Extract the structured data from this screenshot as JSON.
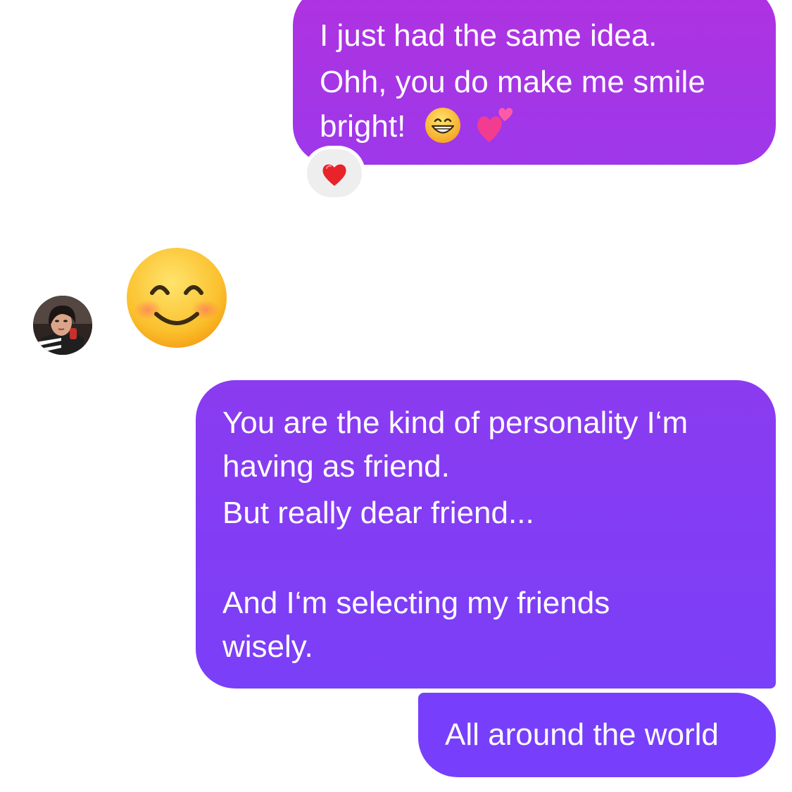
{
  "messages": {
    "first": {
      "line1": "I just had the same idea.",
      "line2": "Ohh, you do make me smile",
      "line3": "bright!",
      "emojis": [
        "grinning-face-icon",
        "two-hearts-icon"
      ],
      "reaction": "red-heart-icon"
    },
    "incoming": {
      "sender": "contact",
      "emoji": "smiling-face-with-smiling-eyes-icon"
    },
    "second": {
      "line1": "You are the kind of personality I‘m",
      "line2": "having as friend.",
      "line3": "But really dear friend...",
      "line4": "And I‘m selecting my friends",
      "line5": "wisely."
    },
    "third": {
      "text": "All around the world"
    }
  },
  "colors": {
    "first_bubble": "#a835e5",
    "second_bubble": "#833df4",
    "third_bubble": "#773ffb",
    "reaction_pill": "#eeeeef"
  }
}
